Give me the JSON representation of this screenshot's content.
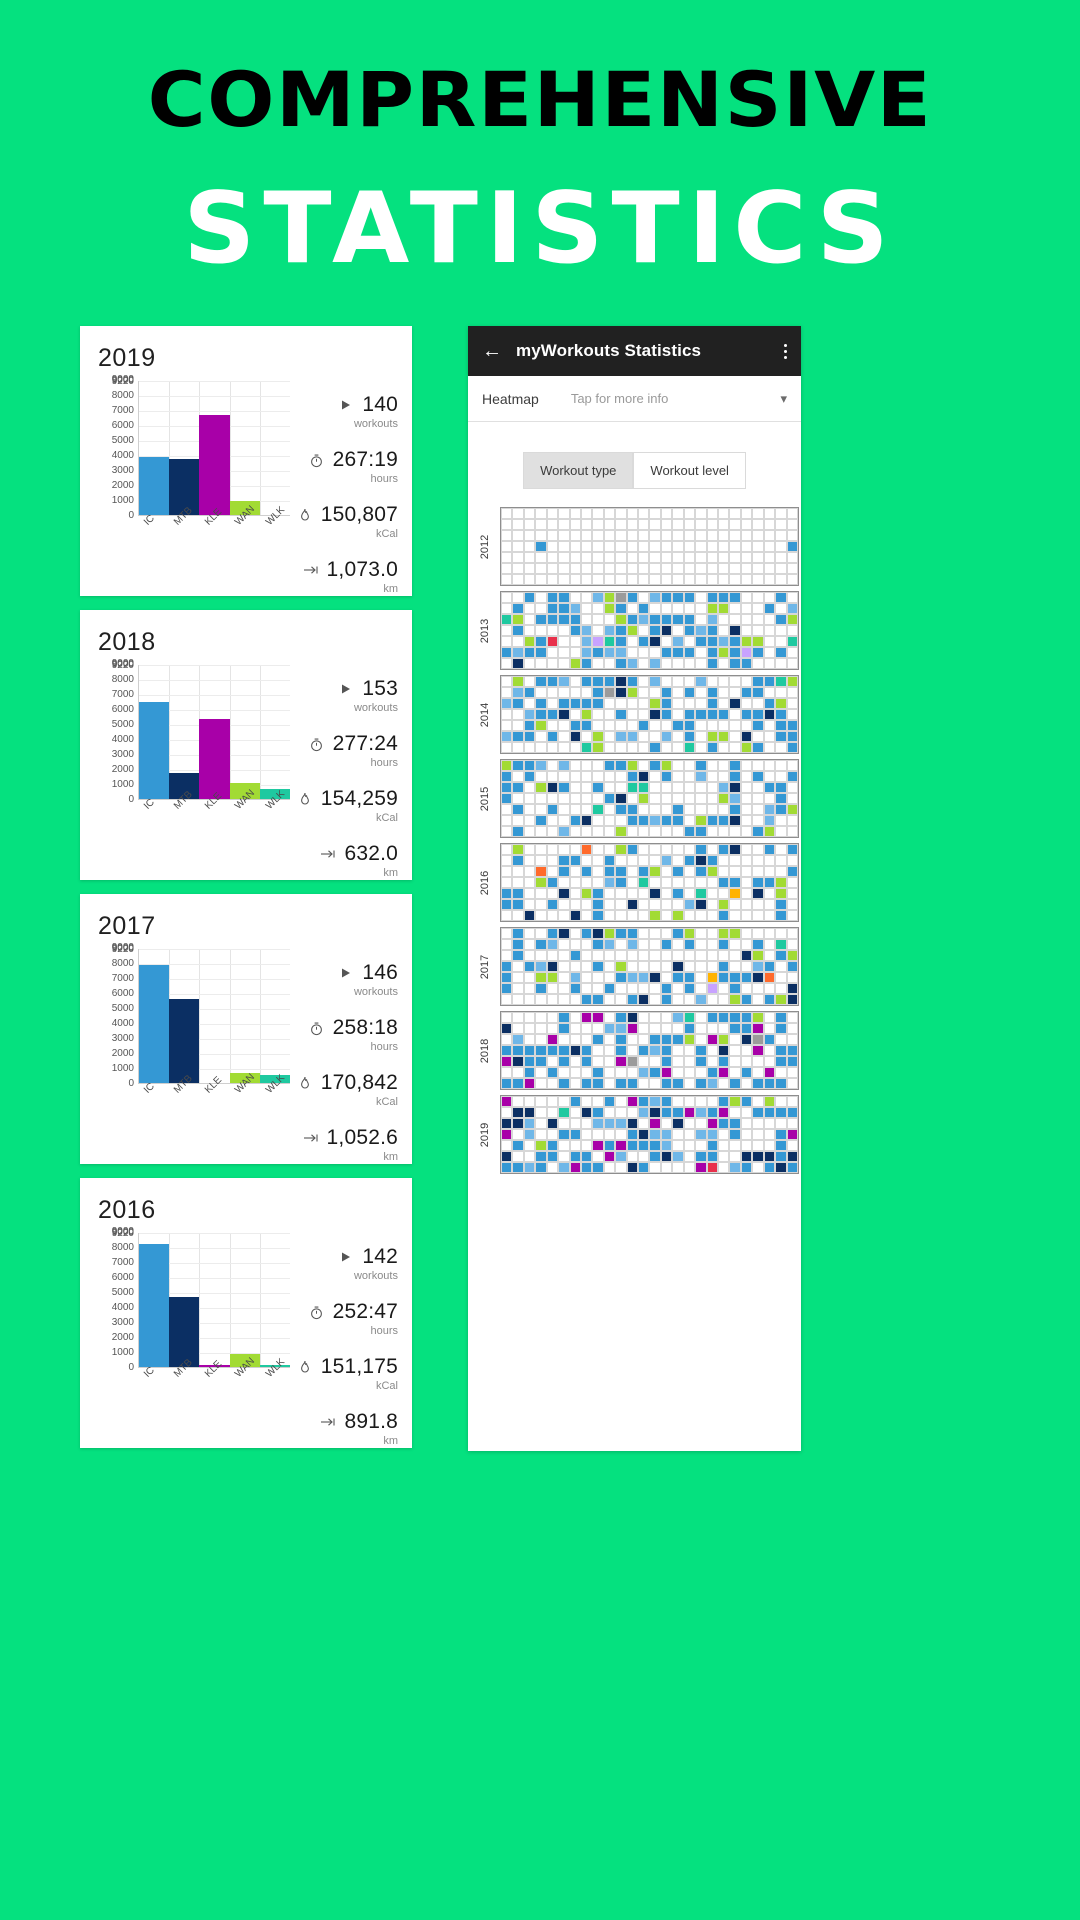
{
  "headline": {
    "line1": "COMPREHENSIVE",
    "line2": "STATISTICS"
  },
  "theme": {
    "background": "#05E17F",
    "headline_line1_color": "#000000",
    "headline_line2_color": "#FFFFFF",
    "appbar_color": "#212121"
  },
  "palette": {
    "IC": "#3498D4",
    "MTB": "#0B2F63",
    "KLE": "#A800A8",
    "WAN": "#A2DB34",
    "WLK": "#1FC9A0"
  },
  "chart_data": [
    {
      "type": "bar",
      "title": "2019",
      "categories": [
        "IC",
        "MTB",
        "KLE",
        "WAN",
        "WLK"
      ],
      "values": [
        3900,
        3750,
        6700,
        950,
        0
      ],
      "ylim": [
        0,
        9000
      ],
      "yticks": [
        0,
        1000,
        2000,
        3000,
        4000,
        5000,
        6000,
        7000,
        8000,
        9000
      ],
      "ytick_overlap_labels": [
        "9000",
        "9220"
      ],
      "xlabel": "",
      "ylabel": "",
      "grid": true,
      "legend": "none"
    },
    {
      "type": "bar",
      "title": "2018",
      "categories": [
        "IC",
        "MTB",
        "KLE",
        "WAN",
        "WLK"
      ],
      "values": [
        6450,
        1750,
        5350,
        1100,
        650
      ],
      "ylim": [
        0,
        9000
      ],
      "yticks": [
        0,
        1000,
        2000,
        3000,
        4000,
        5000,
        6000,
        7000,
        8000,
        9000
      ],
      "ytick_overlap_labels": [
        "9000",
        "9220"
      ],
      "xlabel": "",
      "ylabel": "",
      "grid": true,
      "legend": "none"
    },
    {
      "type": "bar",
      "title": "2017",
      "categories": [
        "IC",
        "MTB",
        "KLE",
        "WAN",
        "WLK"
      ],
      "values": [
        7850,
        5600,
        0,
        700,
        550
      ],
      "ylim": [
        0,
        9000
      ],
      "yticks": [
        0,
        1000,
        2000,
        3000,
        4000,
        5000,
        6000,
        7000,
        8000,
        9000
      ],
      "ytick_overlap_labels": [
        "9000",
        "9220"
      ],
      "xlabel": "",
      "ylabel": "",
      "grid": true,
      "legend": "none"
    },
    {
      "type": "bar",
      "title": "2016",
      "categories": [
        "IC",
        "MTB",
        "KLE",
        "WAN",
        "WLK"
      ],
      "values": [
        8200,
        4700,
        150,
        900,
        120
      ],
      "ylim": [
        0,
        9000
      ],
      "yticks": [
        0,
        1000,
        2000,
        3000,
        4000,
        5000,
        6000,
        7000,
        8000,
        9000
      ],
      "ytick_overlap_labels": [
        "9000",
        "9220"
      ],
      "xlabel": "",
      "ylabel": "",
      "grid": true,
      "legend": "none"
    }
  ],
  "year_cards": [
    {
      "year": "2019",
      "stats": [
        {
          "icon": "play-triangle-icon",
          "value": "140",
          "unit": "workouts"
        },
        {
          "icon": "stopwatch-icon",
          "value": "267:19",
          "unit": "hours"
        },
        {
          "icon": "flame-icon",
          "value": "150,807",
          "unit": "kCal"
        },
        {
          "icon": "distance-arrow-icon",
          "value": "1,073.0",
          "unit": "km"
        }
      ]
    },
    {
      "year": "2018",
      "stats": [
        {
          "icon": "play-triangle-icon",
          "value": "153",
          "unit": "workouts"
        },
        {
          "icon": "stopwatch-icon",
          "value": "277:24",
          "unit": "hours"
        },
        {
          "icon": "flame-icon",
          "value": "154,259",
          "unit": "kCal"
        },
        {
          "icon": "distance-arrow-icon",
          "value": "632.0",
          "unit": "km"
        }
      ]
    },
    {
      "year": "2017",
      "stats": [
        {
          "icon": "play-triangle-icon",
          "value": "146",
          "unit": "workouts"
        },
        {
          "icon": "stopwatch-icon",
          "value": "258:18",
          "unit": "hours"
        },
        {
          "icon": "flame-icon",
          "value": "170,842",
          "unit": "kCal"
        },
        {
          "icon": "distance-arrow-icon",
          "value": "1,052.6",
          "unit": "km"
        }
      ]
    },
    {
      "year": "2016",
      "stats": [
        {
          "icon": "play-triangle-icon",
          "value": "142",
          "unit": "workouts"
        },
        {
          "icon": "stopwatch-icon",
          "value": "252:47",
          "unit": "hours"
        },
        {
          "icon": "flame-icon",
          "value": "151,175",
          "unit": "kCal"
        },
        {
          "icon": "distance-arrow-icon",
          "value": "891.8",
          "unit": "km"
        }
      ]
    }
  ],
  "phone": {
    "appbar": {
      "back_icon": "arrow-left-icon",
      "title": "myWorkouts Statistics",
      "menu_icon": "overflow-menu-icon"
    },
    "selector": {
      "label": "Heatmap",
      "hint": "Tap for more info",
      "chevron_icon": "chevron-down-icon"
    },
    "segmented": {
      "options": [
        "Workout type",
        "Workout level"
      ],
      "selected": "Workout type"
    },
    "heatmap": {
      "years": [
        "2012",
        "2013",
        "2014",
        "2015",
        "2016",
        "2017",
        "2018",
        "2019"
      ],
      "columns": 26,
      "rows": 7,
      "empty_color": "#FFFFFF",
      "colors": [
        "#3498D4",
        "#0B2F63",
        "#A800A8",
        "#A2DB34",
        "#1FC9A0",
        "#6FB7E8",
        "#9B9B9B",
        "#FF6A2B",
        "#FFB300",
        "#C8A2FF",
        "#E8304B"
      ]
    }
  }
}
